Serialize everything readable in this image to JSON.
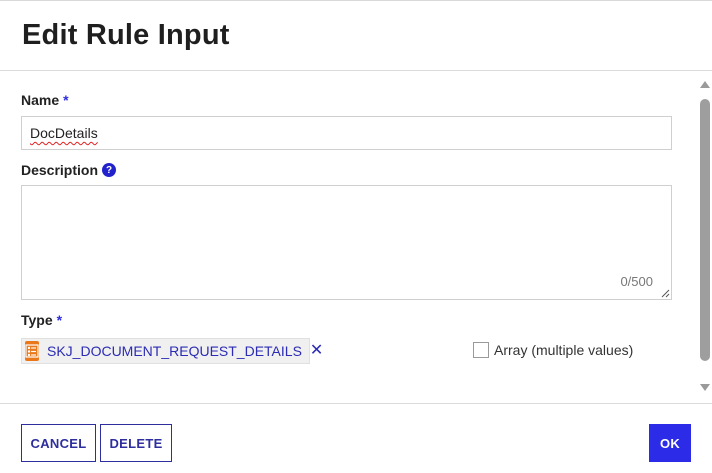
{
  "dialog": {
    "title": "Edit Rule Input"
  },
  "form": {
    "name_label": "Name",
    "required_mark": "*",
    "name_value": "DocDetails",
    "description_label": "Description",
    "help_icon": "?",
    "description_value": "",
    "description_counter": "0/500",
    "type_label": "Type",
    "type_value": "SKJ_DOCUMENT_REQUEST_DETAILS",
    "type_icon": "record-type-icon",
    "array_label": "Array (multiple values)",
    "array_checked": false
  },
  "footer": {
    "cancel_label": "CANCEL",
    "delete_label": "DELETE",
    "ok_label": "OK"
  },
  "colors": {
    "accent": "#2b2be8",
    "required": "#2d2de0",
    "type_icon_bg": "#e8781a",
    "type_text": "#2b2bb5"
  }
}
